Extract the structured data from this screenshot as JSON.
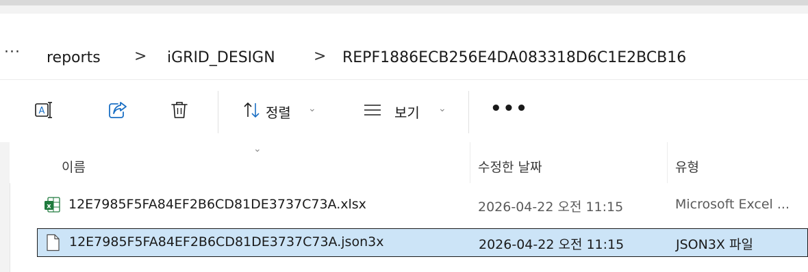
{
  "breadcrumb": {
    "more": "···",
    "items": [
      {
        "label": "reports"
      },
      {
        "label": "iGRID_DESIGN"
      },
      {
        "label": "REPF1886ECB256E4DA083318D6C1E2BCB16"
      }
    ],
    "separator": ">"
  },
  "toolbar": {
    "rename_icon": "rename-icon",
    "share_icon": "share-icon",
    "delete_icon": "trash-icon",
    "sort_label": "정렬",
    "view_label": "보기",
    "more_label": "•••"
  },
  "columns": {
    "name": "이름",
    "date": "수정한 날짜",
    "type": "유형"
  },
  "files": [
    {
      "name": "12E7985F5FA84EF2B6CD81DE3737C73A.xlsx",
      "date": "2026-04-22 오전 11:15",
      "type": "Microsoft Excel ...",
      "icon": "excel-file-icon",
      "selected": false
    },
    {
      "name": "12E7985F5FA84EF2B6CD81DE3737C73A.json3x",
      "date": "2026-04-22 오전 11:15",
      "type": "JSON3X 파일",
      "icon": "generic-file-icon",
      "selected": true
    }
  ],
  "colors": {
    "selection_bg": "#cce4f7",
    "excel_green": "#1f7a3d"
  }
}
